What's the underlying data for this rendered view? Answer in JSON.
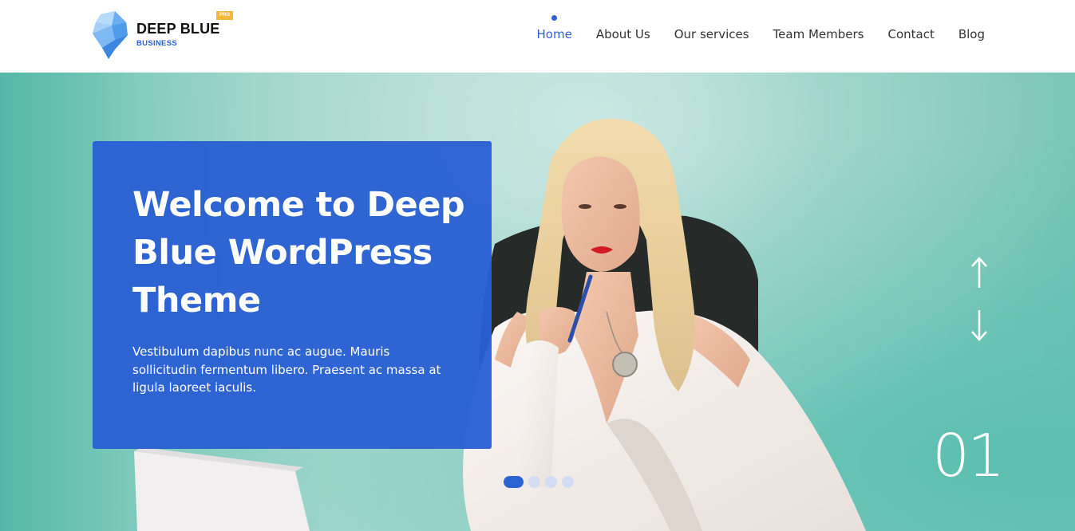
{
  "brand": {
    "name": "DEEP BLUE",
    "tagline": "BUSINESS",
    "badge": "PRO",
    "accent_color": "#2c63d3",
    "badge_color": "#f6b73c",
    "logo_icon": "iceberg-icon"
  },
  "nav": {
    "items": [
      {
        "label": "Home",
        "active": true
      },
      {
        "label": "About Us",
        "active": false
      },
      {
        "label": "Our services",
        "active": false
      },
      {
        "label": "Team Members",
        "active": false
      },
      {
        "label": "Contact",
        "active": false
      },
      {
        "label": "Blog",
        "active": false
      }
    ]
  },
  "hero": {
    "title": "Welcome to Deep Blue WordPress Theme",
    "text": "Vestibulum dapibus nunc ac augue. Mauris sollicitudin fermentum libero. Praesent ac massa at ligula laoreet iaculis.",
    "card_color": "#2a60d2",
    "slide_number": "01",
    "prev_icon": "arrow-up-icon",
    "next_icon": "arrow-down-icon",
    "dots": {
      "count": 4,
      "active_index": 0
    }
  }
}
